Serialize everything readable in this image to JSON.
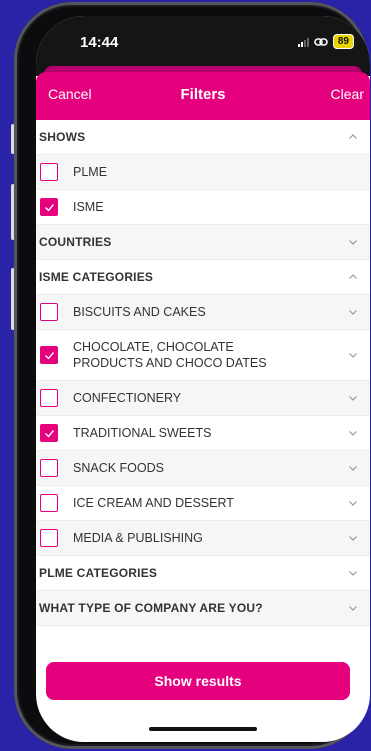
{
  "status": {
    "time": "14:44",
    "battery": "89"
  },
  "header": {
    "cancel": "Cancel",
    "title": "Filters",
    "clear": "Clear"
  },
  "sections": {
    "shows": "SHOWS",
    "countries": "COUNTRIES",
    "isme_categories": "ISME CATEGORIES",
    "plme_categories": "PLME CATEGORIES",
    "company_type": "WHAT TYPE OF COMPANY ARE YOU?"
  },
  "shows": [
    {
      "label": "PLME",
      "checked": false
    },
    {
      "label": "ISME",
      "checked": true
    }
  ],
  "isme_categories": [
    {
      "label": "BISCUITS AND CAKES",
      "checked": false
    },
    {
      "label": "CHOCOLATE, CHOCOLATE",
      "label2": "PRODUCTS AND CHOCO DATES",
      "checked": true
    },
    {
      "label": "CONFECTIONERY",
      "checked": false
    },
    {
      "label": "TRADITIONAL SWEETS",
      "checked": true
    },
    {
      "label": "SNACK FOODS",
      "checked": false
    },
    {
      "label": "ICE CREAM AND DESSERT",
      "checked": false
    },
    {
      "label": "MEDIA & PUBLISHING",
      "checked": false
    }
  ],
  "cta": {
    "label": "Show results"
  },
  "colors": {
    "accent": "#e5007e",
    "background": "#2a23a8"
  },
  "icons": {
    "expand": "chevron-down-icon",
    "collapse": "chevron-up-icon",
    "checked": "check-icon"
  }
}
